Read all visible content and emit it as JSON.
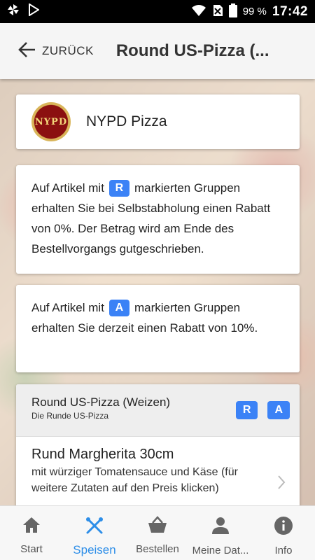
{
  "statusbar": {
    "battery": "99 %",
    "time": "17:42",
    "icons": [
      "pinwheel-icon",
      "play-store-icon",
      "wifi-icon",
      "no-sim-icon",
      "battery-icon"
    ]
  },
  "appbar": {
    "back_label": "ZURÜCK",
    "title": "Round US-Pizza (..."
  },
  "restaurant": {
    "name": "NYPD Pizza",
    "logo_text": "NYPD"
  },
  "info1": {
    "before": "Auf Artikel mit",
    "badge": "R",
    "after": "markierten Gruppen erhalten Sie bei Selbstabholung einen Rabatt von 0%. Der Betrag wird am Ende des Bestellvorgangs gutgeschrieben."
  },
  "info2": {
    "before": "Auf Artikel mit",
    "badge": "A",
    "after": "markierten Gruppen erhalten Sie derzeit einen Rabatt von 10%."
  },
  "group": {
    "name": "Round US-Pizza (Weizen)",
    "subtitle": "Die Runde US-Pizza",
    "badges": [
      "R",
      "A"
    ]
  },
  "item": {
    "name": "Rund Margherita 30cm",
    "description": "mit würziger Tomatensauce und Käse (für weitere Zutaten auf den Preis klicken)"
  },
  "tabs": [
    {
      "label": "Start",
      "icon": "home-icon"
    },
    {
      "label": "Speisen",
      "icon": "cutlery-icon",
      "active": true
    },
    {
      "label": "Bestellen",
      "icon": "basket-icon"
    },
    {
      "label": "Meine Dat...",
      "icon": "person-icon"
    },
    {
      "label": "Info",
      "icon": "info-icon"
    }
  ],
  "colors": {
    "accent": "#2d8ee8",
    "badge": "#3b82f6"
  }
}
